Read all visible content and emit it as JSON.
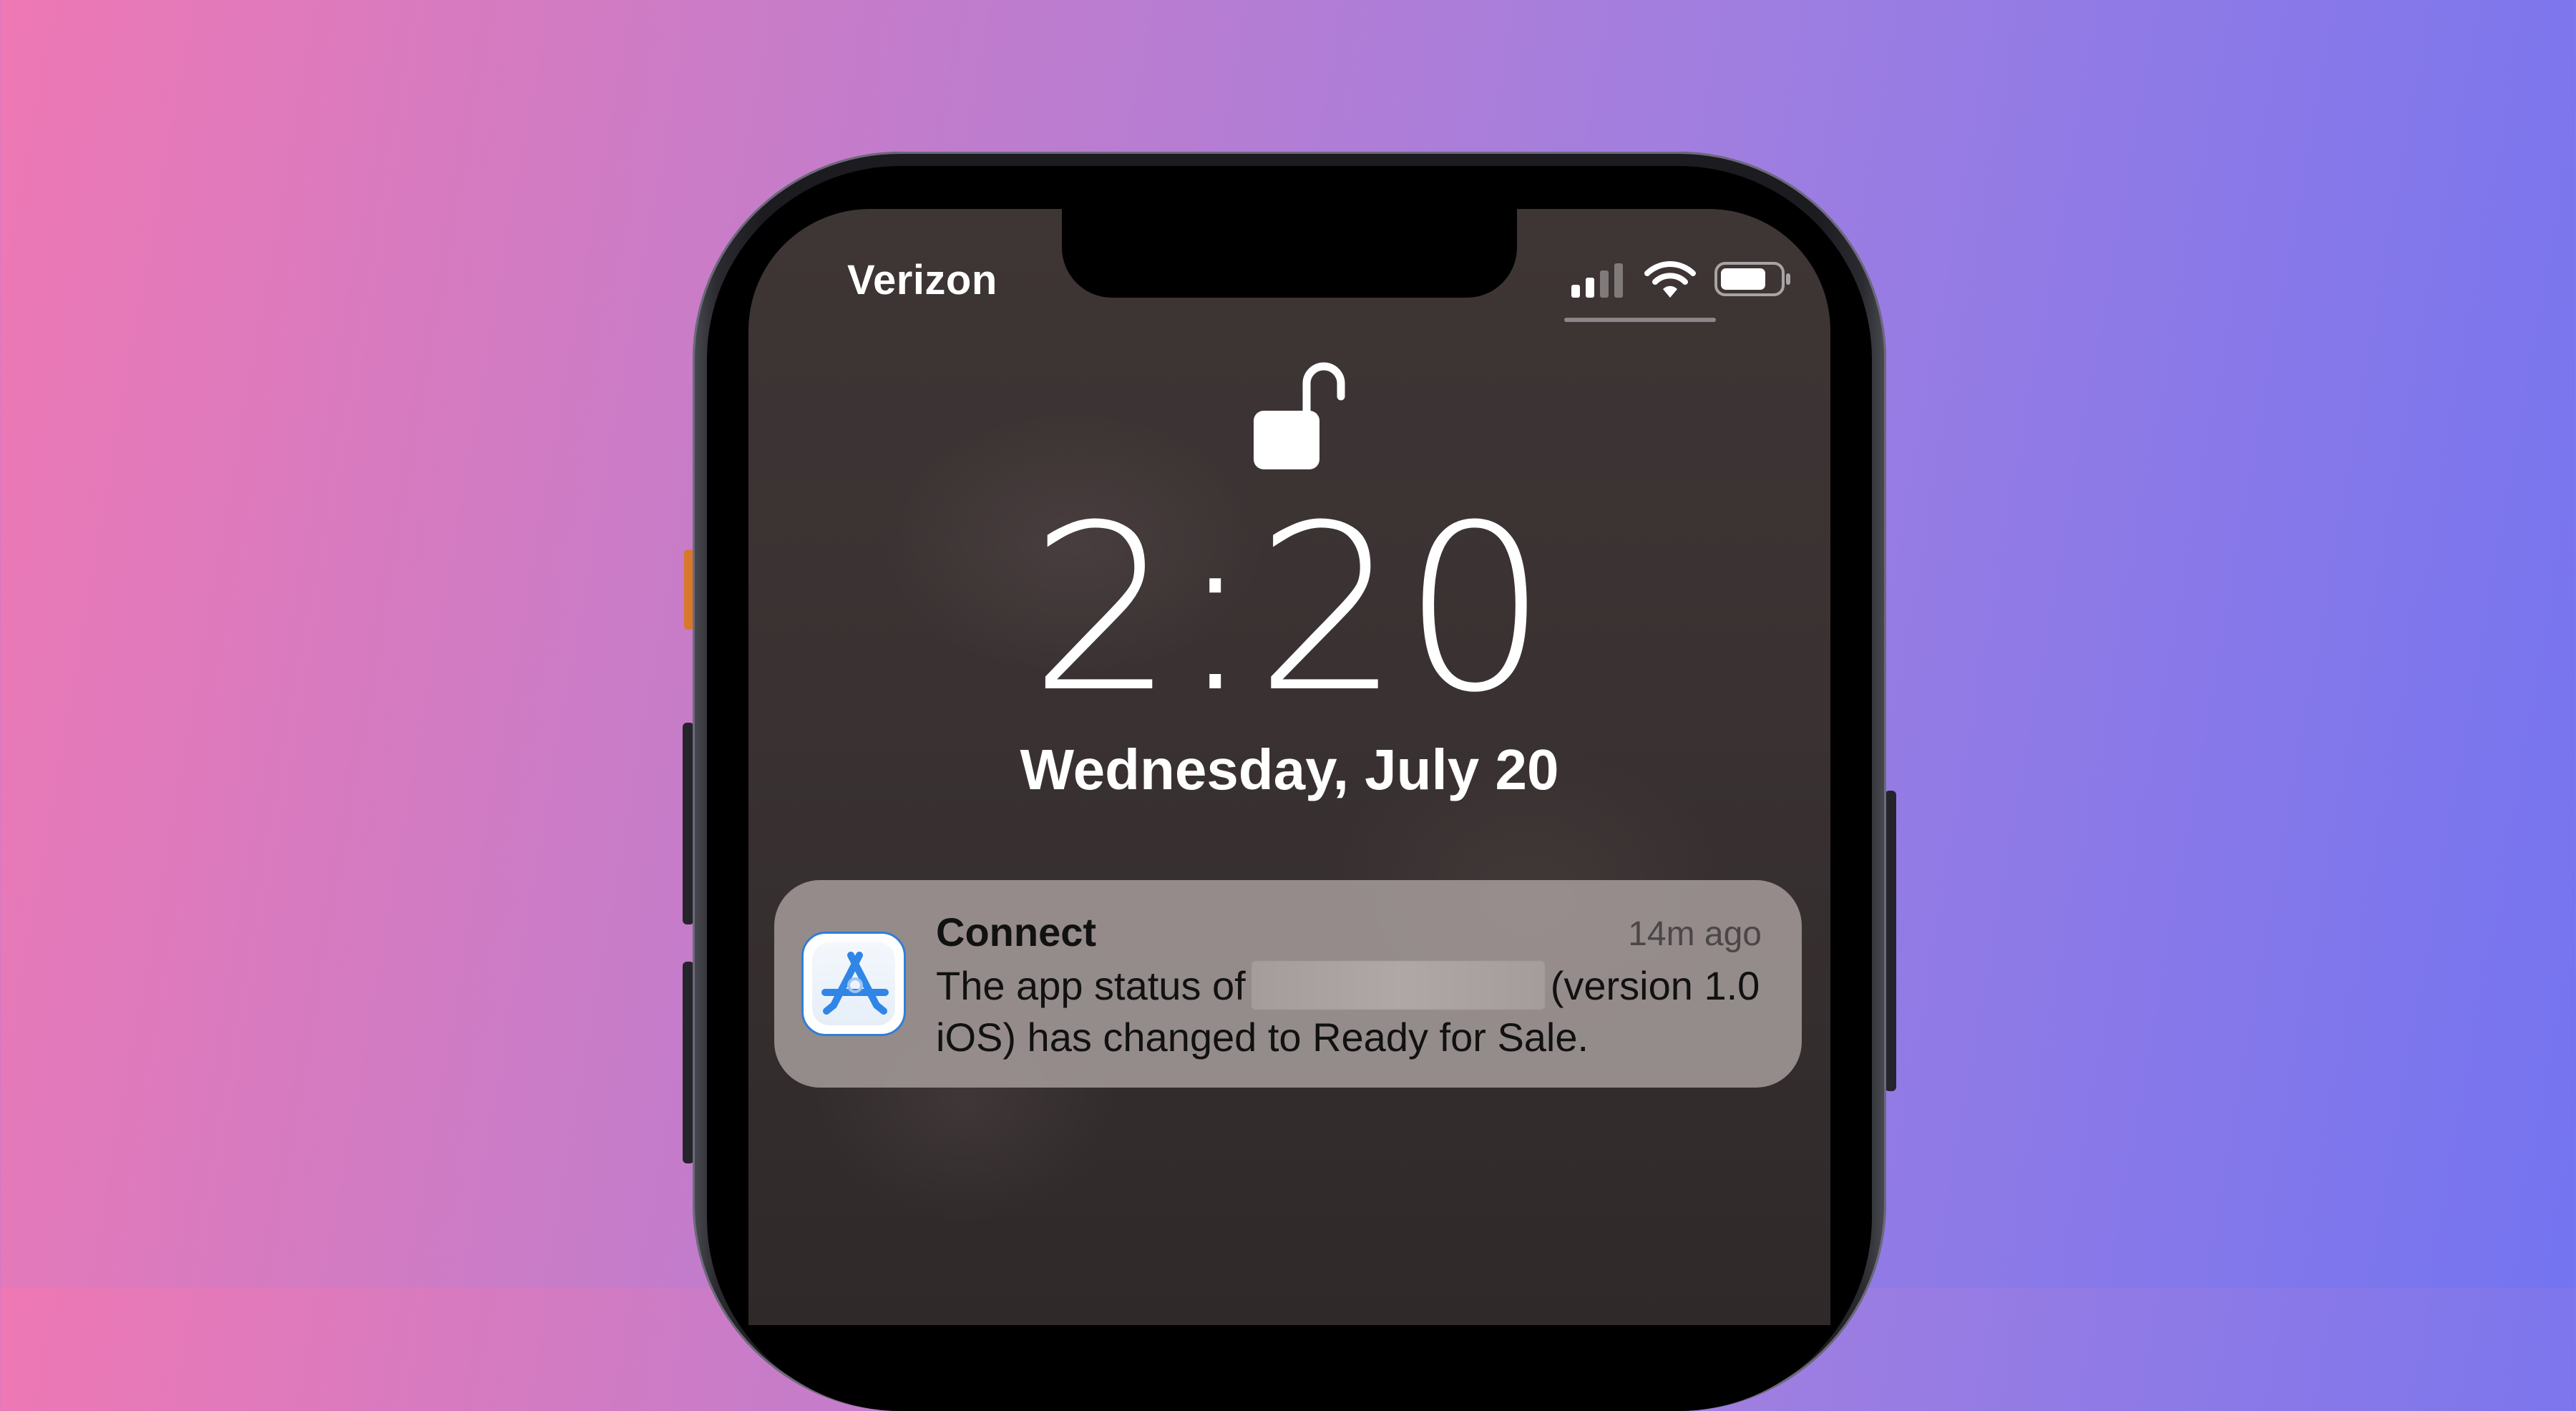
{
  "status_bar": {
    "carrier": "Verizon",
    "signal_bars_active": 2,
    "signal_bars_total": 4
  },
  "lock_screen": {
    "time": "2:20",
    "date": "Wednesday, July 20"
  },
  "notification": {
    "app_name": "Connect",
    "age": "14m ago",
    "body_prefix": "The app status of",
    "body_suffix": "(version 1.0 iOS) has changed to Ready for Sale."
  },
  "icons": {
    "lock": "open-padlock-icon",
    "app": "app-store-connect-icon"
  },
  "colors": {
    "app_icon_blue": "#2f7ed8",
    "mute_switch": "#d8782a"
  }
}
